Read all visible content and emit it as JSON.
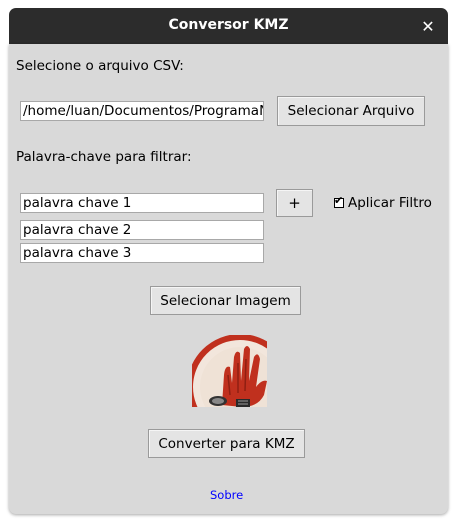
{
  "window": {
    "title": "Conversor KMZ",
    "close_glyph": "✕"
  },
  "csv": {
    "label": "Selecione o arquivo CSV:",
    "path_value": "/home/luan/Documentos/ProgramaNo",
    "select_button": "Selecionar Arquivo"
  },
  "filter": {
    "label": "Palavra-chave para filtrar:",
    "keywords": [
      "palavra chave 1",
      "palavra chave 2",
      "palavra chave 3"
    ],
    "add_button": "+",
    "apply_checkbox_label": "Aplicar Filtro",
    "apply_checked": true
  },
  "image": {
    "select_button": "Selecionar Imagem",
    "preview_icon": "red-handprint-logo-icon"
  },
  "actions": {
    "convert_button": "Converter para KMZ",
    "about_link": "Sobre"
  },
  "colors": {
    "titlebar": "#2c2c2c",
    "background": "#d9d9d9",
    "link": "#0000ff",
    "logo_red": "#c0301e"
  }
}
